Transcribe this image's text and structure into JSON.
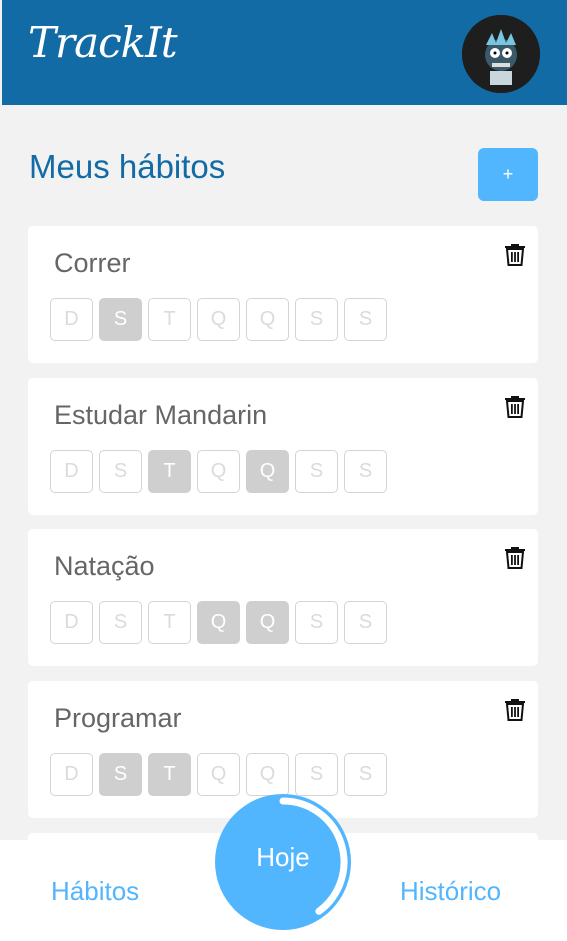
{
  "header": {
    "logo": "TrackIt",
    "avatar_icon": "avatar-image"
  },
  "main": {
    "title": "Meus hábitos",
    "add_label": "+"
  },
  "habits": [
    {
      "name": "Correr",
      "days": [
        {
          "label": "D",
          "on": false
        },
        {
          "label": "S",
          "on": true
        },
        {
          "label": "T",
          "on": false
        },
        {
          "label": "Q",
          "on": false
        },
        {
          "label": "Q",
          "on": false
        },
        {
          "label": "S",
          "on": false
        },
        {
          "label": "S",
          "on": false
        }
      ]
    },
    {
      "name": "Estudar Mandarin",
      "days": [
        {
          "label": "D",
          "on": false
        },
        {
          "label": "S",
          "on": false
        },
        {
          "label": "T",
          "on": true
        },
        {
          "label": "Q",
          "on": false
        },
        {
          "label": "Q",
          "on": true
        },
        {
          "label": "S",
          "on": false
        },
        {
          "label": "S",
          "on": false
        }
      ]
    },
    {
      "name": "Natação",
      "days": [
        {
          "label": "D",
          "on": false
        },
        {
          "label": "S",
          "on": false
        },
        {
          "label": "T",
          "on": false
        },
        {
          "label": "Q",
          "on": true
        },
        {
          "label": "Q",
          "on": true
        },
        {
          "label": "S",
          "on": false
        },
        {
          "label": "S",
          "on": false
        }
      ]
    },
    {
      "name": "Programar",
      "days": [
        {
          "label": "D",
          "on": false
        },
        {
          "label": "S",
          "on": true
        },
        {
          "label": "T",
          "on": true
        },
        {
          "label": "Q",
          "on": false
        },
        {
          "label": "Q",
          "on": false
        },
        {
          "label": "S",
          "on": false
        },
        {
          "label": "S",
          "on": false
        }
      ]
    }
  ],
  "footer": {
    "habits_label": "Hábitos",
    "today_label": "Hoje",
    "history_label": "Histórico",
    "today_progress": 0.4
  },
  "colors": {
    "primary": "#126ba5",
    "accent": "#52b6ff",
    "day_selected": "#cfcfcf"
  }
}
